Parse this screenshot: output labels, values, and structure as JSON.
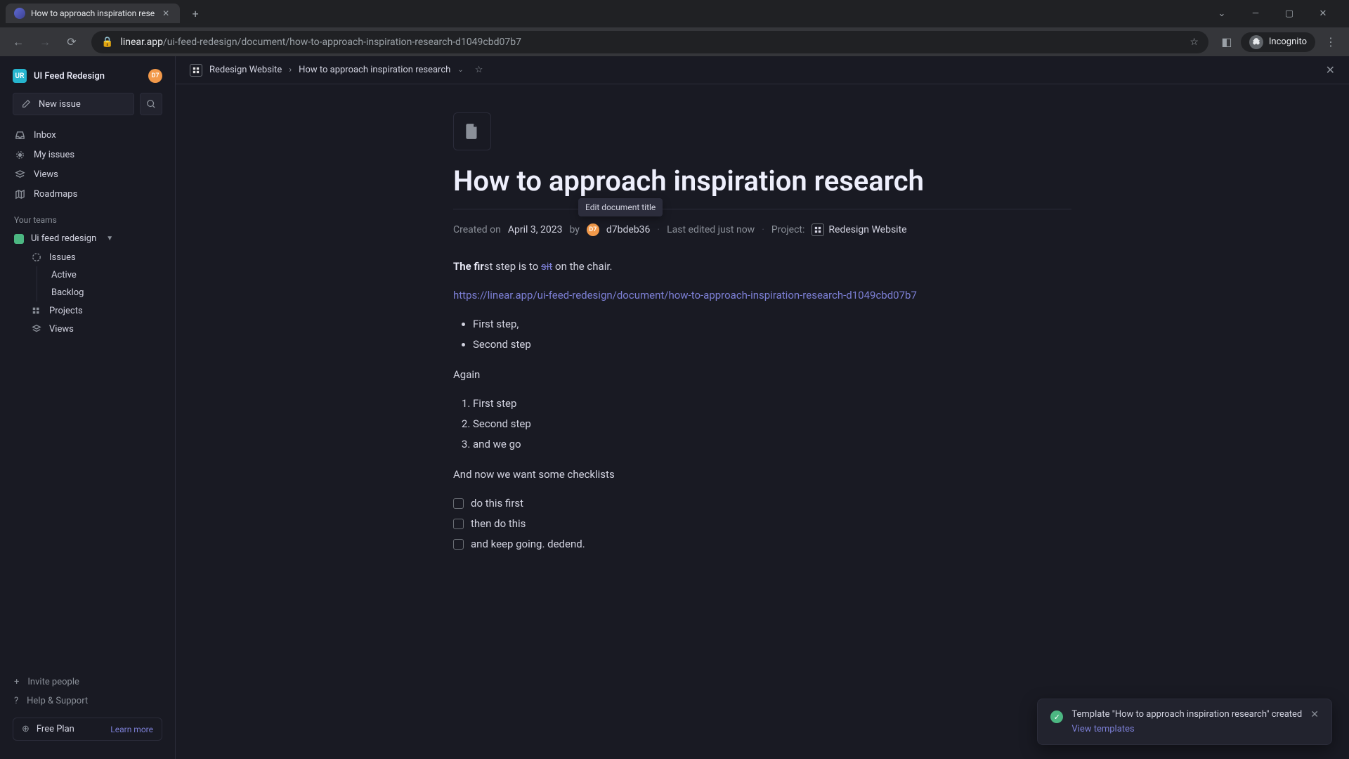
{
  "browser": {
    "tab_title": "How to approach inspiration rese",
    "url_host": "linear.app",
    "url_path": "/ui-feed-redesign/document/how-to-approach-inspiration-research-d1049cbd07b7",
    "incognito_label": "Incognito"
  },
  "workspace": {
    "avatar_initials": "UR",
    "name": "UI Feed Redesign",
    "user_avatar": "D7"
  },
  "sidebar": {
    "new_issue": "New issue",
    "nav": {
      "inbox": "Inbox",
      "my_issues": "My issues",
      "views": "Views",
      "roadmaps": "Roadmaps"
    },
    "section_label": "Your teams",
    "team_name": "Ui feed redesign",
    "team_items": {
      "issues": "Issues",
      "active": "Active",
      "backlog": "Backlog",
      "projects": "Projects",
      "views": "Views"
    },
    "footer": {
      "invite": "Invite people",
      "help": "Help & Support",
      "plan": "Free Plan",
      "learn_more": "Learn more"
    }
  },
  "breadcrumb": {
    "project": "Redesign Website",
    "page": "How to approach inspiration research"
  },
  "document": {
    "title": "How to approach inspiration research",
    "tooltip": "Edit document title",
    "meta": {
      "created_prefix": "Created on",
      "date": "April 3, 2023",
      "by": "by",
      "user_avatar": "D7",
      "user": "d7bdeb36",
      "edited": "Last edited just now",
      "project_label": "Project:",
      "project": "Redesign Website"
    },
    "body": {
      "p1_bold": "The fir",
      "p1_mid": "st step is to ",
      "p1_strike": "sit",
      "p1_end": " on the chair.",
      "link": "https://linear.app/ui-feed-redesign/document/how-to-approach-inspiration-research-d1049cbd07b7",
      "ul": [
        "First step,",
        "Second step"
      ],
      "p2": "Again",
      "ol": [
        "First step",
        "Second step",
        "and we go"
      ],
      "p3": "And now we want some checklists",
      "checklist": [
        "do this first",
        "then do this",
        "and keep going. dedend."
      ]
    }
  },
  "toast": {
    "message": "Template \"How to approach inspiration research\" created",
    "link": "View templates"
  }
}
